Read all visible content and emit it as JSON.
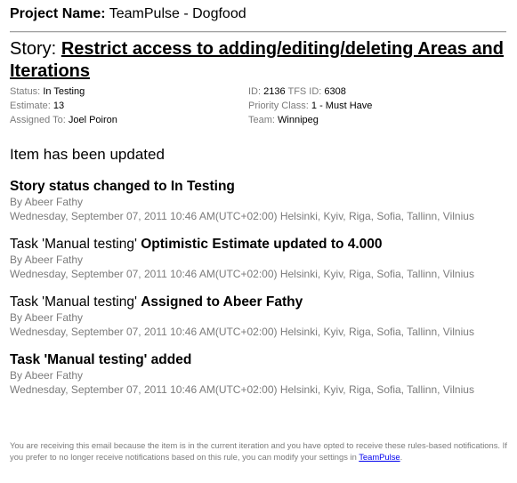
{
  "project": {
    "label": "Project Name:",
    "name": "TeamPulse - Dogfood"
  },
  "story": {
    "label": "Story:",
    "title": "Restrict access to adding/editing/deleting Areas and Iterations"
  },
  "details": {
    "status": {
      "label": "Status:",
      "value": "In Testing"
    },
    "estimate": {
      "label": "Estimate:",
      "value": "13"
    },
    "assigned_to": {
      "label": "Assigned To:",
      "value": "Joel Poiron"
    },
    "id": {
      "label": "ID:",
      "value": "2136"
    },
    "tfs_id": {
      "label": "TFS ID:",
      "value": "6308"
    },
    "priority_class": {
      "label": "Priority Class:",
      "value": "1 - Must Have"
    },
    "team": {
      "label": "Team:",
      "value": "Winnipeg"
    }
  },
  "updated_heading": "Item has been updated",
  "events": [
    {
      "prefix": "",
      "bold": "Story status changed to In Testing",
      "by": "By Abeer Fathy",
      "timestamp": "Wednesday, September 07, 2011 10:46 AM(UTC+02:00) Helsinki, Kyiv, Riga, Sofia, Tallinn, Vilnius"
    },
    {
      "prefix": "Task 'Manual testing' ",
      "bold": "Optimistic Estimate updated to 4.000",
      "by": "By Abeer Fathy",
      "timestamp": "Wednesday, September 07, 2011 10:46 AM(UTC+02:00) Helsinki, Kyiv, Riga, Sofia, Tallinn, Vilnius"
    },
    {
      "prefix": "Task 'Manual testing' ",
      "bold": "Assigned to Abeer Fathy",
      "by": "By Abeer Fathy",
      "timestamp": "Wednesday, September 07, 2011 10:46 AM(UTC+02:00) Helsinki, Kyiv, Riga, Sofia, Tallinn, Vilnius"
    },
    {
      "prefix": "",
      "bold": "Task 'Manual testing' added",
      "by": "By Abeer Fathy",
      "timestamp": "Wednesday, September 07, 2011 10:46 AM(UTC+02:00) Helsinki, Kyiv, Riga, Sofia, Tallinn, Vilnius"
    }
  ],
  "footer": {
    "text": "You are receiving this email because the item is in the current iteration and you have opted to receive these rules-based notifications. If you prefer to no longer receive notifications based on this rule, you can modify your settings in ",
    "link_text": "TeamPulse",
    "suffix": "."
  }
}
